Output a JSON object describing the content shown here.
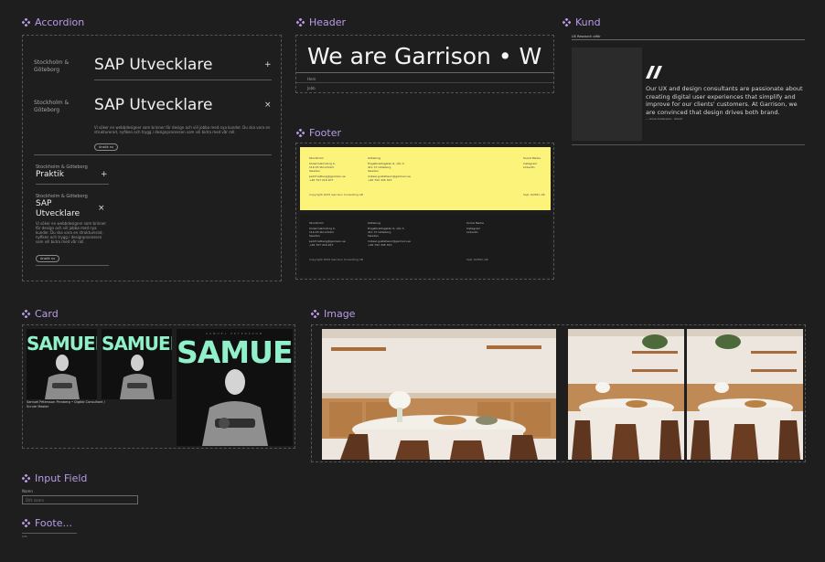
{
  "sections": {
    "accordion": "Accordion",
    "header": "Header",
    "kund": "Kund",
    "footer": "Footer",
    "card": "Card",
    "image": "Image",
    "input_field": "Input Field",
    "foote": "Foote..."
  },
  "accordion": {
    "items": [
      {
        "city": "Stockholm & Göteborg",
        "title": "SAP Utvecklare",
        "icon": "+"
      },
      {
        "city": "Stockholm & Göteborg",
        "title": "SAP Utvecklare",
        "icon": "×",
        "body": "Vi söker en webbdesigner som brinner för design och vill jobba med nya kunder. Du ska vara en strukturerad, nyfiken och trygg i designprocessen som vill bidra med vår roll.",
        "button": "Ansök nu"
      },
      {
        "city": "Stockholm & Göteborg",
        "title": "Praktik",
        "icon": "+"
      },
      {
        "city": "Stockholm & Göteborg",
        "title": "SAP Utvecklare",
        "icon": "×",
        "body": "Vi söker en webbdesigner som brinner för design och vill jobba med nya kunder. Du ska vara en strukturerad, nyfiken och trygg i designprocessen som vill bidra med vår roll.",
        "button": "Ansök nu"
      }
    ]
  },
  "header": {
    "marquee": "We are Garrison • W",
    "link1": "Hem",
    "link2": "Jobb"
  },
  "kund": {
    "top_label": "UX Research utför",
    "quote": "Our UX and design consultants are passionate about creating digital user experiences that simplify and improve for our clients' customers. At Garrison, we are convinced that design drives both brand.",
    "author": "— Anna Andersson · Klient"
  },
  "footer": {
    "light": {
      "col1_title": "Stockholm",
      "col1_lines": [
        "Södermalmstorg 4,",
        "116 45 Stockholm",
        "Sweden"
      ],
      "col1_mail": "pell.frostberg@garrison.se",
      "col1_phone": "+46 707 216 207",
      "col2_title": "Göteborg",
      "col2_lines": [
        "Engelbrektsgatan 6, vån 3,",
        "411 37 Göteborg",
        "Sweden"
      ],
      "col2_mail": "mikael.gustafsson@garrison.se",
      "col2_phone": "+46 702 445 323",
      "col3_title": "Social Media",
      "col3_lines": [
        "Instagram",
        "LinkedIn"
      ],
      "copyright": "Copyright 2025 Garrison Consulting AB",
      "credit": "Sajt: Ostfilm AB"
    },
    "dark": {
      "col1_title": "Stockholm",
      "col1_lines": [
        "Södermalmstorg 4,",
        "116 45 Stockholm",
        "Sweden"
      ],
      "col1_mail": "pell.frostberg@garrison.se",
      "col1_phone": "+46 707 216 207",
      "col2_title": "Göteborg",
      "col2_lines": [
        "Engelbrektsgatan 6, vån 3,",
        "411 37 Göteborg",
        "Sweden"
      ],
      "col2_mail": "mikael.gustafsson@garrison.se",
      "col2_phone": "+46 702 445 323",
      "col3_title": "Social Media",
      "col3_lines": [
        "Instagram",
        "LinkedIn"
      ],
      "copyright": "Copyright 2025 Garrison Consulting AB",
      "credit": "Sajt: Ostfilm AB"
    }
  },
  "card": {
    "name": "SAMUEL",
    "subtitle": "SAMUEL PETERSSON",
    "caption": "Samuel Petersson Pinnberg • Digital Consultant / Scrum Master"
  },
  "input": {
    "label": "Namn",
    "placeholder": "Ditt namn"
  },
  "foote": {
    "label": "Info"
  },
  "colors": {
    "accent": "#b89ce8",
    "footer_light": "#fcf37a",
    "card_title": "#8ff0c9",
    "background": "#1e1e1e"
  }
}
